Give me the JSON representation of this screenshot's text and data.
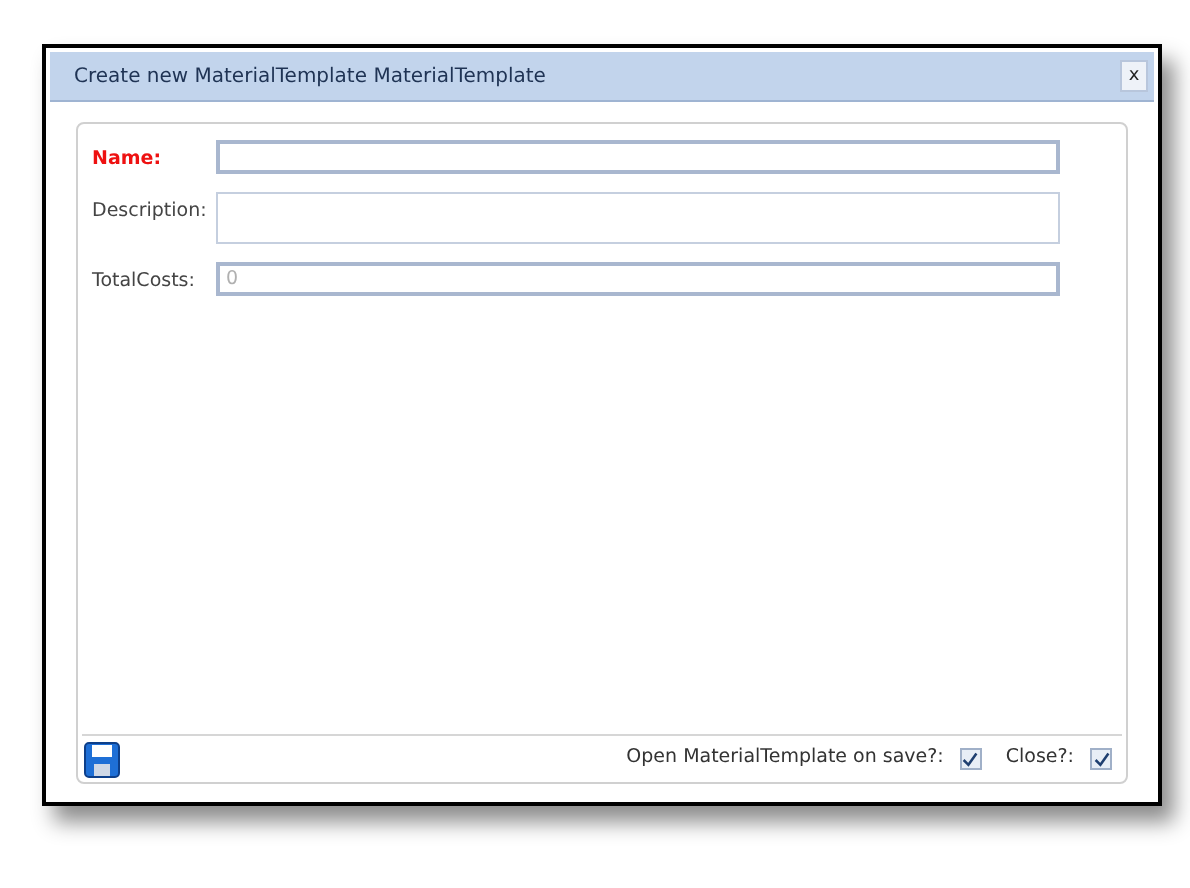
{
  "window": {
    "title": "Create new MaterialTemplate MaterialTemplate",
    "close": "x"
  },
  "fields": [
    {
      "label": "Name:",
      "kind": "text",
      "required": true
    },
    {
      "label": "Description:",
      "kind": "multiline",
      "required": false
    },
    {
      "label": "TotalCosts:",
      "kind": "text",
      "required": false,
      "placeholder": "0"
    }
  ],
  "footer": {
    "options": [
      {
        "label": "Open MaterialTemplate on save?:",
        "checked": true
      },
      {
        "label": "Close?:",
        "checked": true
      }
    ]
  }
}
